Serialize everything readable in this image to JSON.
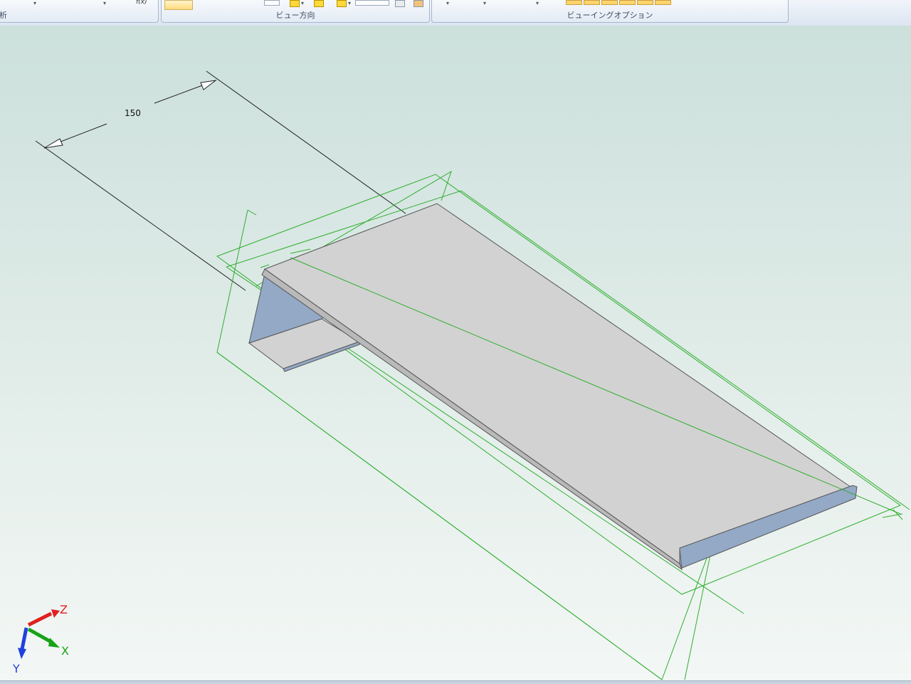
{
  "ribbon": {
    "groups": [
      {
        "label": "析"
      },
      {
        "label": "ビュー方向"
      },
      {
        "label": "ビューイングオプション"
      }
    ],
    "fx_label": "f(x)"
  },
  "viewport": {
    "dimension_label": "150",
    "colors": {
      "sheet_top": "#d2d2d2",
      "sheet_flange": "#93a9c6",
      "reference_planes": "#2fae2f",
      "dimension_lines": "#202020"
    }
  },
  "triad": {
    "x_label": "X",
    "y_label": "Y",
    "z_label": "Z",
    "colors": {
      "x": "#17a317",
      "y": "#2040e0",
      "z": "#e02020"
    }
  }
}
